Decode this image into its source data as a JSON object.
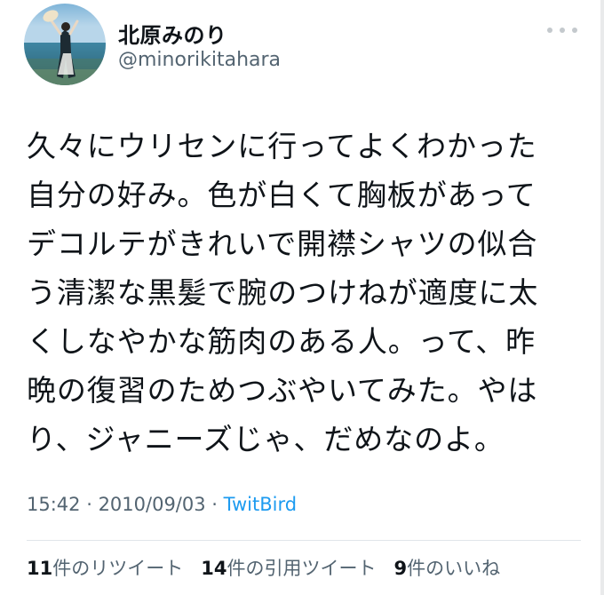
{
  "user": {
    "display_name": "北原みのり",
    "handle": "@minorikitahara"
  },
  "tweet": {
    "lines": [
      "久々にウリセンに行ってよくわかった",
      "自分の好み。色が白くて胸板があって",
      "デコルテがきれいで開襟シャツの似合",
      "う清潔な黒髪で腕のつけねが適度に太",
      "くしなやかな筋肉のある人。って、昨",
      "晩の復習のためつぶやいてみた。やは",
      "り、ジャニーズじゃ、だめなのよ。"
    ],
    "time": "15:42",
    "separator1": " · ",
    "date": "2010/09/03",
    "separator2": " · ",
    "source": "TwitBird"
  },
  "stats": {
    "retweets_count": "11",
    "retweets_label": "件のリツイート",
    "quotes_count": "14",
    "quotes_label": "件の引用ツイート",
    "likes_count": "9",
    "likes_label": "件のいいね"
  },
  "icons": {
    "more": "more-horizontal-icon"
  },
  "colors": {
    "text": "#0f1419",
    "secondary": "#536471",
    "link": "#1d9bf0",
    "divider": "#e1e6ea"
  }
}
